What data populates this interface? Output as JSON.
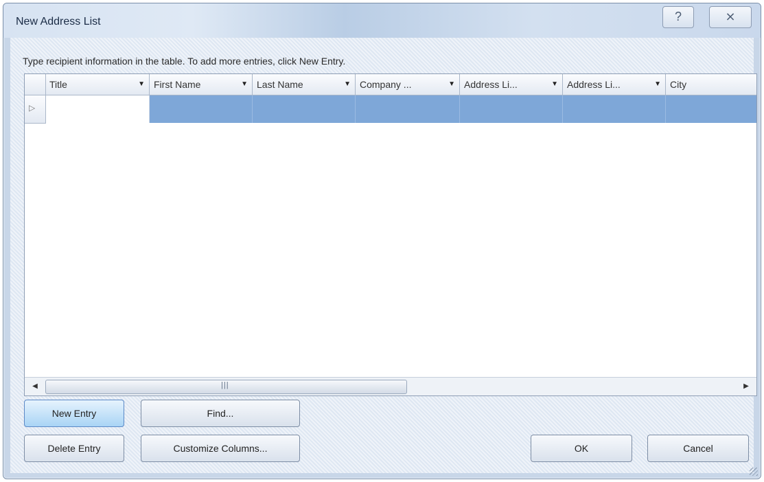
{
  "window": {
    "title": "New Address List",
    "help_glyph": "?",
    "close_glyph": "⨯"
  },
  "instructions": "Type recipient information in the table.  To add more entries, click New Entry.",
  "table": {
    "columns": [
      {
        "label": "Title"
      },
      {
        "label": "First Name"
      },
      {
        "label": "Last Name"
      },
      {
        "label": "Company ..."
      },
      {
        "label": "Address Li..."
      },
      {
        "label": "Address Li..."
      },
      {
        "label": "City"
      }
    ],
    "dropdown_glyph": "▼",
    "row_indicator_glyph": "▷",
    "selection_color": "#7ea7d8"
  },
  "scrollbar": {
    "left_glyph": "◀",
    "right_glyph": "▶",
    "grip_glyph": "|||"
  },
  "buttons": {
    "new_entry": "New Entry",
    "find": "Find...",
    "delete_entry": "Delete Entry",
    "customize_columns": "Customize Columns...",
    "ok": "OK",
    "cancel": "Cancel"
  }
}
